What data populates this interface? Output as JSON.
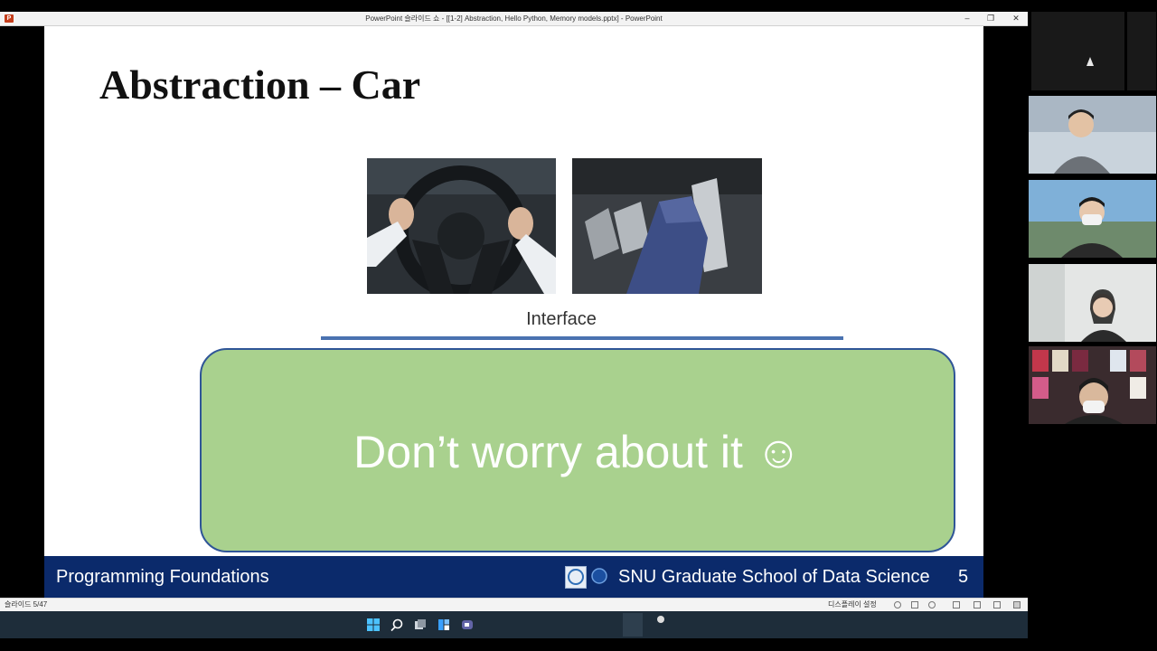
{
  "window": {
    "title": "PowerPoint 슬라이드 쇼 - [[1-2] Abstraction, Hello Python, Memory models.pptx] - PowerPoint",
    "minimize_label": "–",
    "restore_label": "❐",
    "close_label": "✕"
  },
  "slide": {
    "title": "Abstraction – Car",
    "interface_label": "Interface",
    "callout_text": "Don’t worry about it ☺",
    "footer": {
      "left": "Programming Foundations",
      "right": "SNU Graduate School of Data Science",
      "page_number": "5"
    }
  },
  "statusbar": {
    "slide_indicator": "슬라이드 5/47",
    "display_settings": "디스플레이 설정"
  },
  "taskbar": {
    "icons": [
      "windows-start-icon",
      "search-icon",
      "task-view-icon",
      "widgets-icon",
      "chat-icon"
    ]
  },
  "colors": {
    "footer_bg": "#0b2a6b",
    "callout_fill": "#a9d18e",
    "callout_border": "#2f5597",
    "interface_line": "#4a72b0"
  }
}
